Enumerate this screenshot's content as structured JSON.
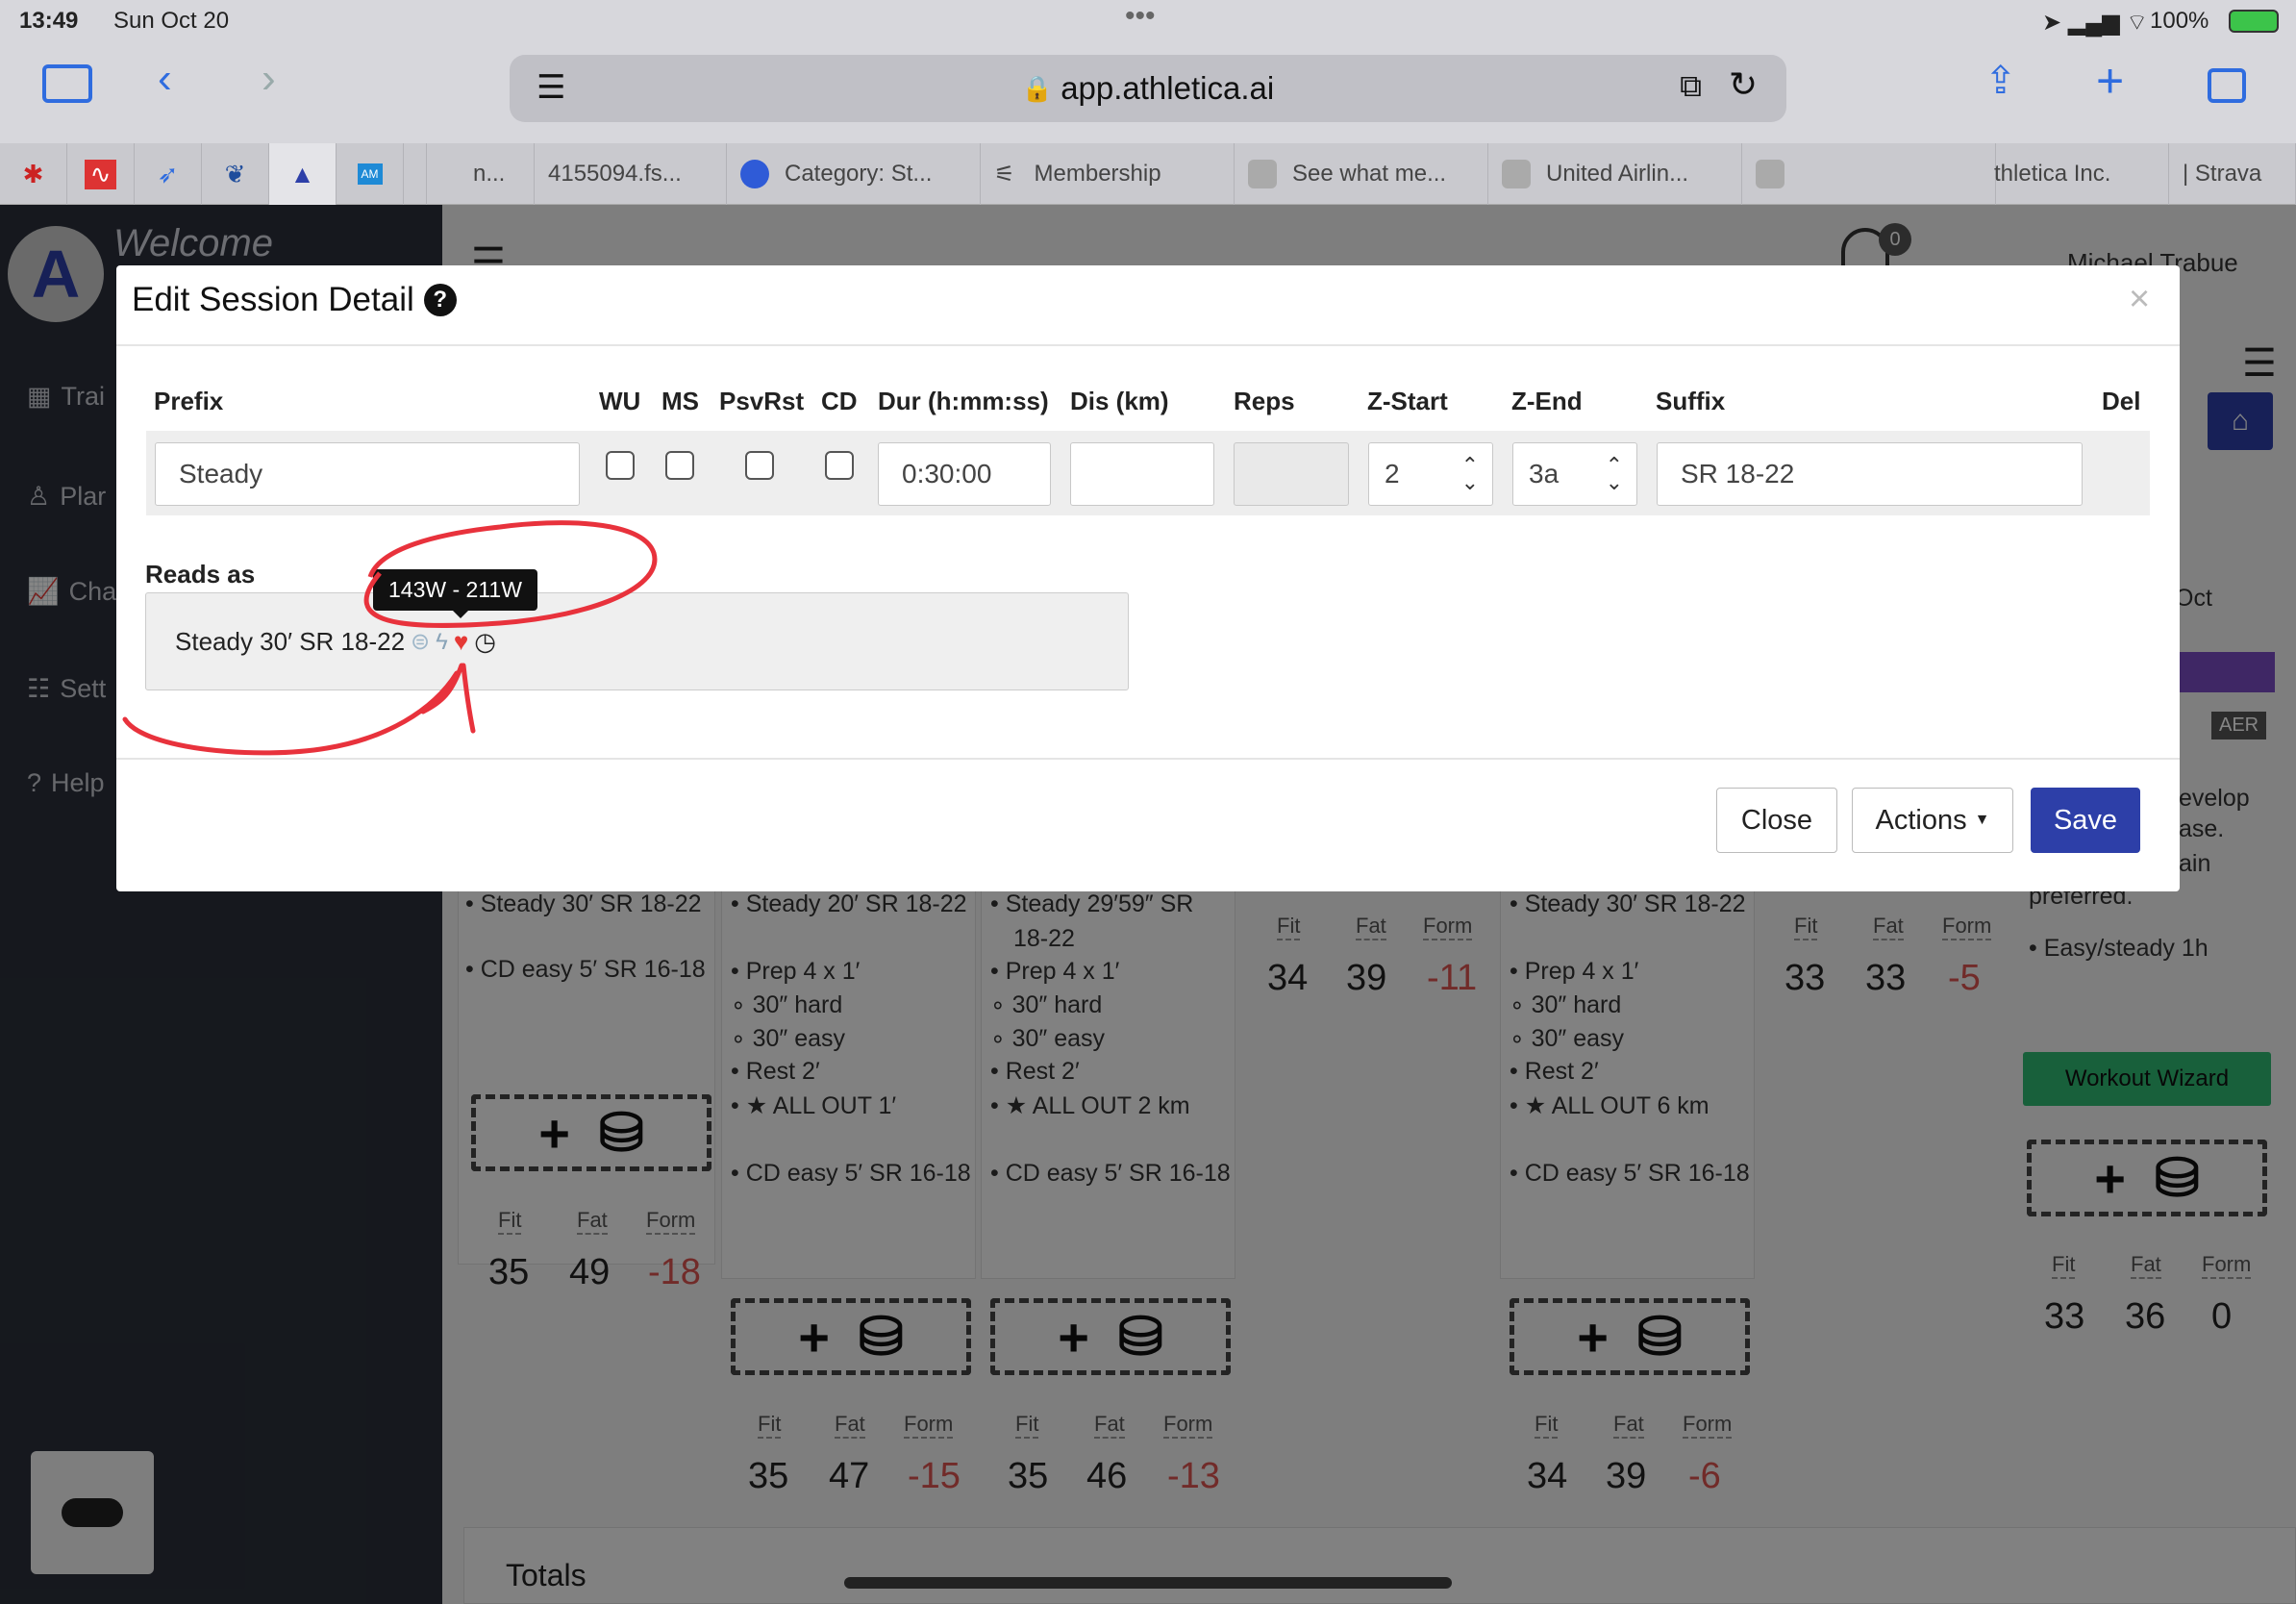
{
  "status_bar": {
    "time": "13:49",
    "date": "Sun Oct 20",
    "battery": "100%"
  },
  "browser": {
    "url": "app.athletica.ai"
  },
  "tabs": [
    {
      "label": "n..."
    },
    {
      "label": "4155094.fs..."
    },
    {
      "label": "Category: St..."
    },
    {
      "label": "Membership"
    },
    {
      "label": "See what me..."
    },
    {
      "label": "United Airlin..."
    },
    {
      "label": "thletica Inc."
    },
    {
      "label": "| Strava"
    }
  ],
  "app": {
    "welcome": "Welcome",
    "user_name": "Michael Trabue",
    "notification_count": "0",
    "sidebar": [
      {
        "label": "Trai"
      },
      {
        "label": "Plar"
      },
      {
        "label": "Cha"
      },
      {
        "label": "Sett"
      },
      {
        "label": "Help"
      }
    ],
    "right_panel": {
      "month": "Oct",
      "badge": "AER",
      "text_lines": [
        "evelop",
        "ase.",
        "ain",
        "preferred."
      ],
      "workout": "Easy/steady 1h",
      "wizard": "Workout Wizard"
    },
    "totals": "Totals"
  },
  "columns": [
    {
      "items": [
        "Steady 30′ SR 18-22",
        "CD easy 5′ SR 16-18"
      ],
      "fit": "35",
      "fat": "49",
      "form": "-18"
    },
    {
      "items": [
        "Steady 20′ SR 18-22",
        "Prep 4 x 1′",
        "30″ hard",
        "30″ easy",
        "Rest 2′",
        "ALL OUT 1′",
        "CD easy 5′ SR 16-18"
      ],
      "fit": "35",
      "fat": "47",
      "form": "-15"
    },
    {
      "items": [
        "Steady 29′59″ SR",
        "18-22",
        "Prep 4 x 1′",
        "30″ hard",
        "30″ easy",
        "Rest 2′",
        "ALL OUT 2 km",
        "CD easy 5′ SR 16-18"
      ],
      "fit": "35",
      "fat": "46",
      "form": "-13"
    },
    {
      "items": [],
      "fit": "34",
      "fat": "39",
      "form": "-11"
    },
    {
      "items": [
        "Steady 30′ SR 18-22",
        "Prep 4 x 1′",
        "30″ hard",
        "30″ easy",
        "Rest 2′",
        "ALL OUT 6 km",
        "CD easy 5′ SR 16-18"
      ],
      "fit": "34",
      "fat": "39",
      "form": "-6"
    },
    {
      "items": [],
      "fit": "33",
      "fat": "33",
      "form": "-5"
    },
    {
      "items": [],
      "fit": "33",
      "fat": "36",
      "form": "0"
    }
  ],
  "fit_labels": {
    "fit": "Fit",
    "fat": "Fat",
    "form": "Form"
  },
  "modal": {
    "title": "Edit Session Detail",
    "headers": {
      "prefix": "Prefix",
      "wu": "WU",
      "ms": "MS",
      "psvrst": "PsvRst",
      "cd": "CD",
      "dur": "Dur (h:mm:ss)",
      "dis": "Dis (km)",
      "reps": "Reps",
      "zstart": "Z-Start",
      "zend": "Z-End",
      "suffix": "Suffix",
      "del": "Del"
    },
    "values": {
      "prefix": "Steady",
      "dur": "0:30:00",
      "dis": "",
      "reps": "",
      "zstart": "2",
      "zend": "3a",
      "suffix": "SR 18-22"
    },
    "reads_as_label": "Reads as",
    "reads_as_text": "Steady 30′ SR 18-22",
    "tooltip": "143W - 211W",
    "buttons": {
      "close": "Close",
      "actions": "Actions",
      "save": "Save"
    }
  },
  "colors": {
    "primary": "#2d3fa8",
    "danger": "#d9534f",
    "success": "#2eb872",
    "sidebar": "#2b2f3a",
    "annotation": "#e8323c"
  }
}
